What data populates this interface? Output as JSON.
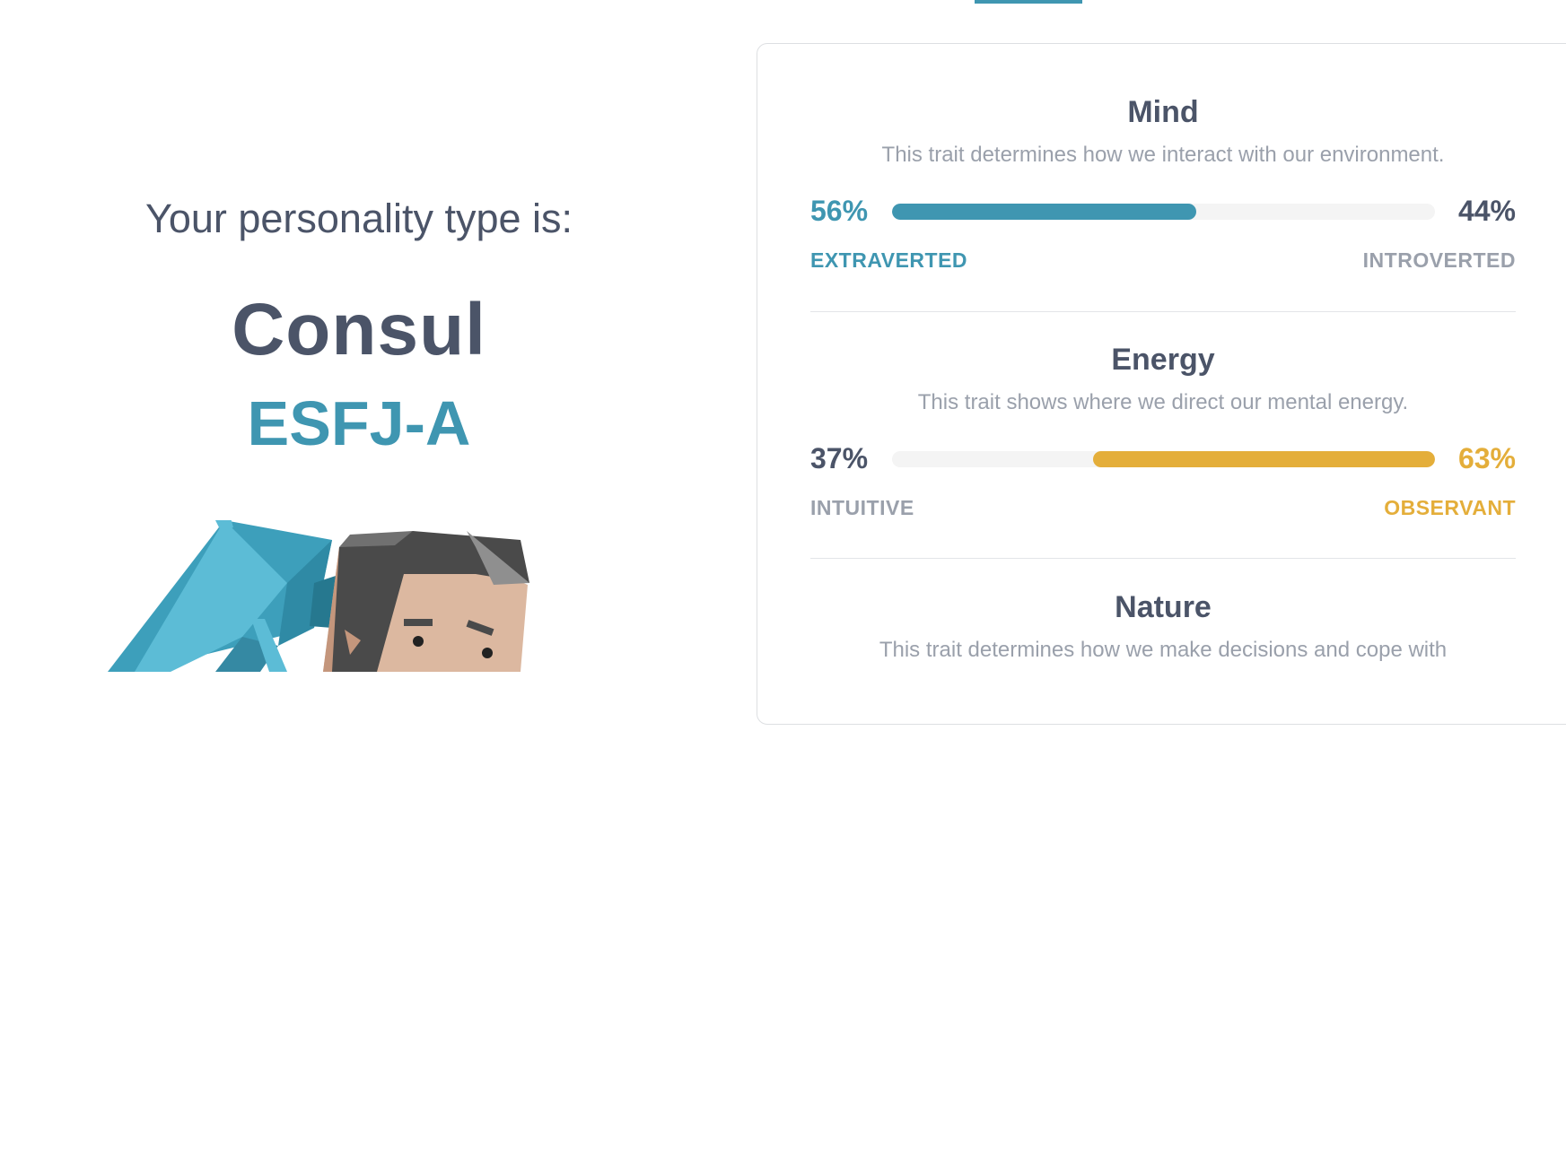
{
  "header": {
    "active_tab_color": "#3f96b1"
  },
  "result": {
    "intro": "Your personality type is:",
    "type_name": "Consul",
    "type_code": "ESFJ-A"
  },
  "colors": {
    "dark_text": "#4b5468",
    "muted_text": "#9aa0ab",
    "mind_accent": "#3f96b1",
    "energy_accent": "#e4ae3a",
    "track": "#f4f4f4"
  },
  "traits": [
    {
      "title": "Mind",
      "description": "This trait determines how we interact with our environment.",
      "left_percent": "56%",
      "right_percent": "44%",
      "left_label": "EXTRAVERTED",
      "right_label": "INTROVERTED",
      "dominant": "left",
      "dominant_value": 0.56
    },
    {
      "title": "Energy",
      "description": "This trait shows where we direct our mental energy.",
      "left_percent": "37%",
      "right_percent": "63%",
      "left_label": "INTUITIVE",
      "right_label": "OBSERVANT",
      "dominant": "right",
      "dominant_value": 0.63
    },
    {
      "title": "Nature",
      "description": "This trait determines how we make decisions and cope with"
    }
  ],
  "illustration": {
    "icon": "consul-umbrella-character-illustration"
  }
}
